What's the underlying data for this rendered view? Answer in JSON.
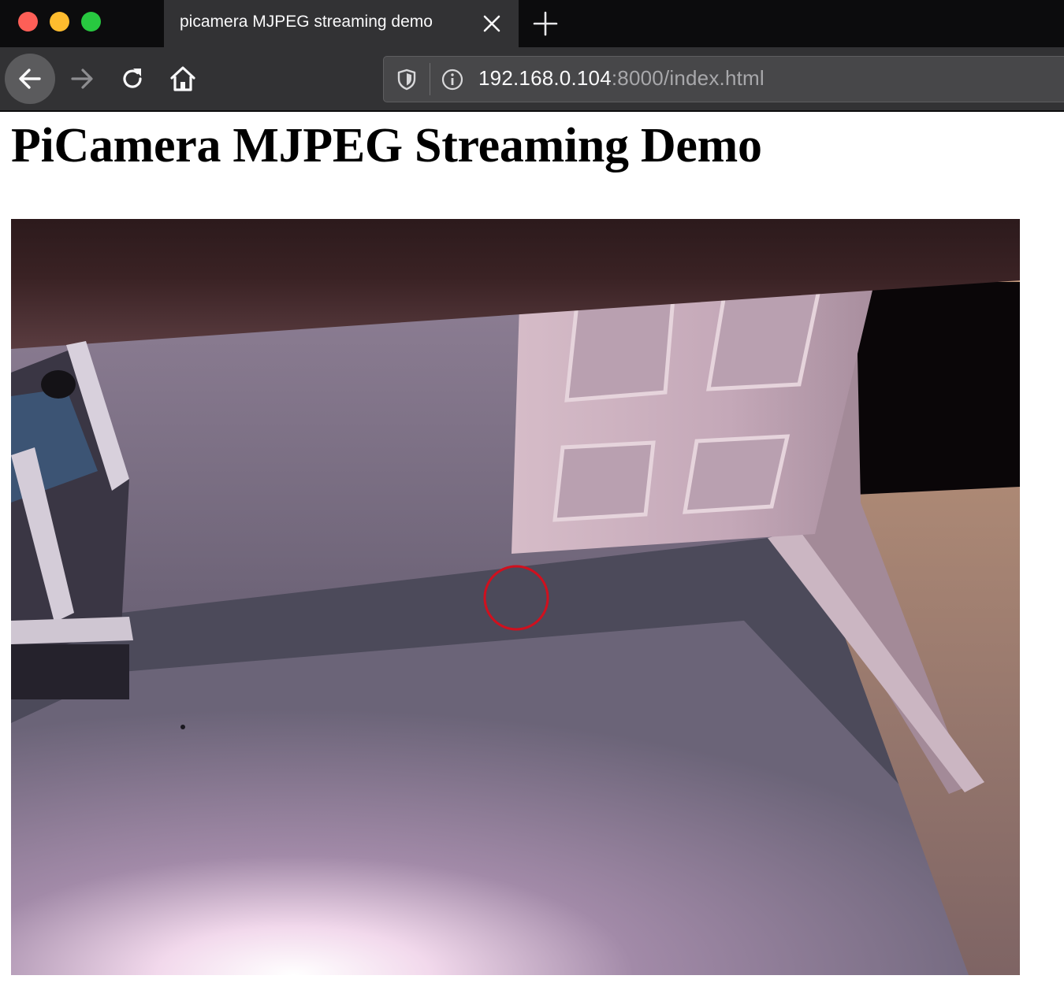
{
  "browser": {
    "tab_title": "picamera MJPEG streaming demo",
    "url_host": "192.168.0.104",
    "url_path": ":8000/index.html"
  },
  "page": {
    "title": "PiCamera MJPEG Streaming Demo"
  },
  "icons": {
    "close": "close-icon",
    "minimize": "minimize-icon",
    "maximize": "maximize-icon",
    "tab_close": "close-icon",
    "new_tab": "plus-icon",
    "back": "arrow-left-icon",
    "forward": "arrow-right-icon",
    "reload": "reload-icon",
    "home": "home-icon",
    "tracking": "shield-icon",
    "site_info": "info-icon"
  },
  "colors": {
    "chrome_dark": "#0c0c0d",
    "toolbar": "#323234",
    "target_circle": "#d0101e"
  }
}
